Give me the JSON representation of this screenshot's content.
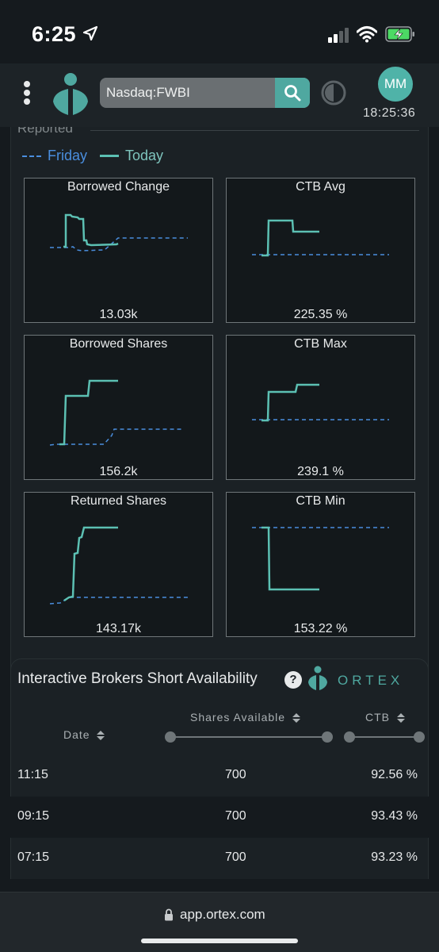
{
  "status_bar": {
    "time": "6:25"
  },
  "header": {
    "search_value": "Nasdaq:FWBI",
    "avatar_initials": "MM",
    "clock": "18:25:36"
  },
  "reported_section": {
    "heading": "Reported",
    "legend": {
      "friday": "Friday",
      "today": "Today"
    },
    "colors": {
      "friday": "#4a8ede",
      "today": "#5cc0b3"
    }
  },
  "charts": [
    {
      "title": "Borrowed Change",
      "value": "13.03k"
    },
    {
      "title": "CTB Avg",
      "value": "225.35 %"
    },
    {
      "title": "Borrowed Shares",
      "value": "156.2k"
    },
    {
      "title": "CTB Max",
      "value": "239.1 %"
    },
    {
      "title": "Returned Shares",
      "value": "143.17k"
    },
    {
      "title": "CTB Min",
      "value": "153.22 %"
    }
  ],
  "ib_panel": {
    "title": "Interactive Brokers Short Availability",
    "help_label": "?",
    "brand": "ORTEX",
    "columns": {
      "date": "Date",
      "shares": "Shares Available",
      "ctb": "CTB"
    },
    "rows": [
      {
        "time": "11:15",
        "shares": "700",
        "ctb": "92.56 %"
      },
      {
        "time": "09:15",
        "shares": "700",
        "ctb": "93.43 %"
      },
      {
        "time": "07:15",
        "shares": "700",
        "ctb": "93.23 %"
      }
    ]
  },
  "browser": {
    "url": "app.ortex.com"
  }
}
